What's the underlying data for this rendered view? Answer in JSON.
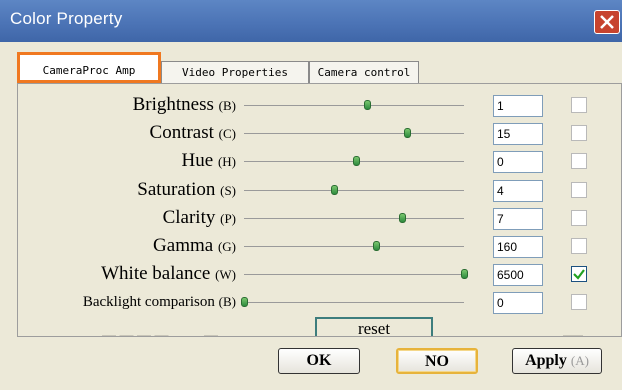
{
  "window": {
    "title": "Color Property"
  },
  "tabs": [
    {
      "label": "CameraProc Amp",
      "active": true
    },
    {
      "label": "Video Properties",
      "active": false
    },
    {
      "label": "Camera control",
      "active": false
    }
  ],
  "rows": [
    {
      "name": "Brightness",
      "accel": "(B)",
      "value": "1",
      "level": 0.56,
      "auto": false
    },
    {
      "name": "Contrast",
      "accel": "(C)",
      "value": "15",
      "level": 0.74,
      "auto": false
    },
    {
      "name": "Hue",
      "accel": "(H)",
      "value": "0",
      "level": 0.51,
      "auto": false
    },
    {
      "name": "Saturation",
      "accel": "(S)",
      "value": "4",
      "level": 0.41,
      "auto": false
    },
    {
      "name": "Clarity",
      "accel": "(P)",
      "value": "7",
      "level": 0.72,
      "auto": false
    },
    {
      "name": "Gamma",
      "accel": "(G)",
      "value": "160",
      "level": 0.6,
      "auto": false
    },
    {
      "name": "White balance",
      "accel": "(W)",
      "value": "6500",
      "level": 1.0,
      "auto": true
    },
    {
      "name": "Backlight comparison",
      "accel": "(B)",
      "value": "0",
      "level": 0.0,
      "auto": false
    }
  ],
  "reset_label": "reset",
  "buttons": {
    "ok": "OK",
    "no": "NO",
    "apply": "Apply",
    "apply_accel": "(A)"
  },
  "colors": {
    "titlebar": "#4c74b6",
    "active_tab_border": "#f07820",
    "thumb": "#2d8a3e",
    "close_button": "#c7432e"
  }
}
